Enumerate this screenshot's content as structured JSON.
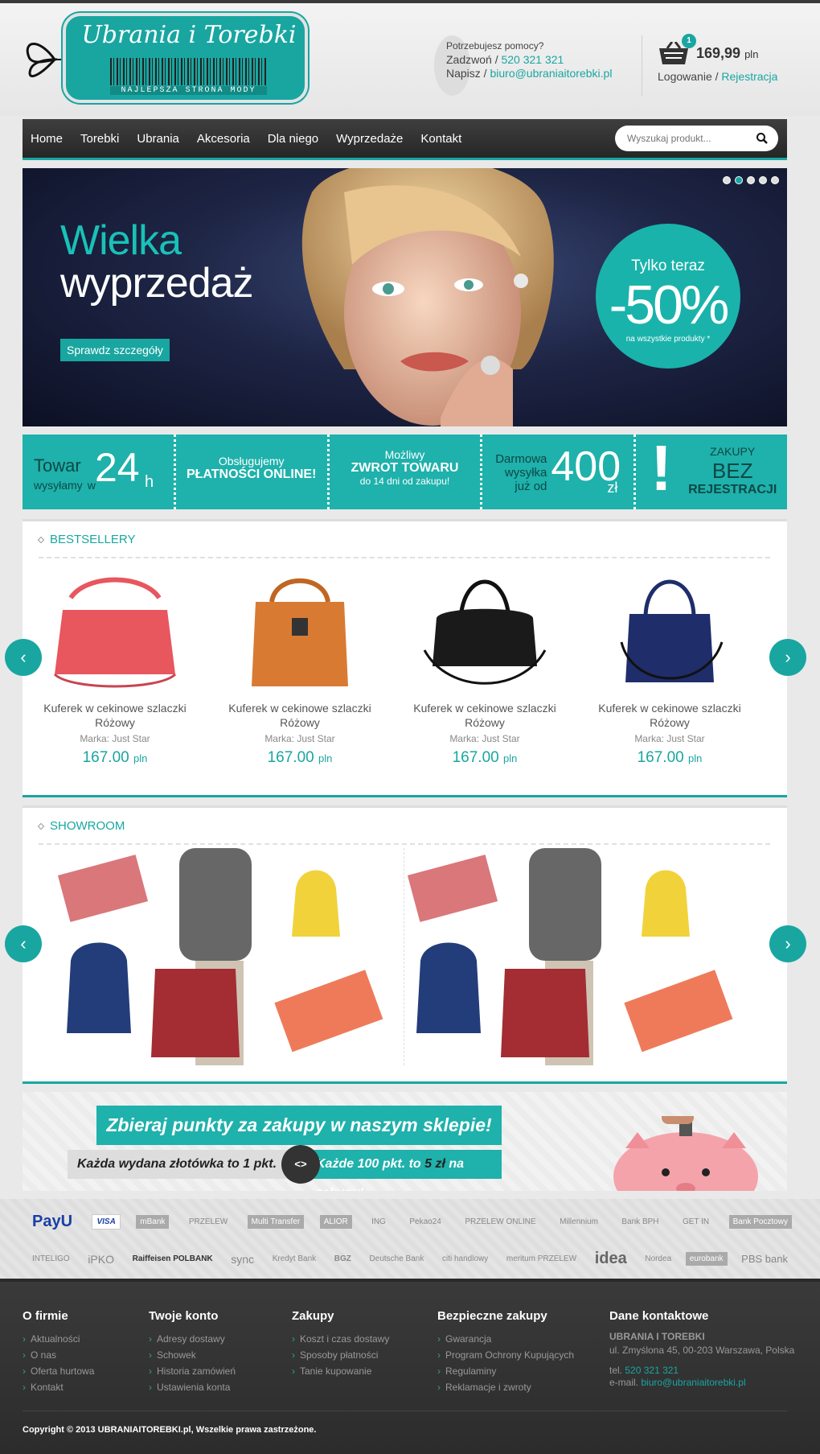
{
  "header": {
    "logo_title": "Ubrania i Torebki",
    "logo_subtitle": "NAJLEPSZA STRONA MODY",
    "help_title": "Potrzebujesz pomocy?",
    "call_label": "Zadzwoń",
    "phone": "520 321 321",
    "write_label": "Napisz",
    "email": "biuro@ubraniaitorebki.pl",
    "cart_count": "1",
    "cart_total": "169,99",
    "currency": "pln",
    "login": "Logowanie",
    "register": "Rejestracja"
  },
  "nav": {
    "items": [
      "Home",
      "Torebki",
      "Ubrania",
      "Akcesoria",
      "Dla niego",
      "Wyprzedaże",
      "Kontakt"
    ],
    "search_placeholder": "Wyszukaj produkt..."
  },
  "hero": {
    "title1": "Wielka",
    "title2": "wyprzedaż",
    "button": "Sprawdz szczegóły",
    "promo_top": "Tylko teraz",
    "promo_big": "-50%",
    "promo_small": "na wszystkie produkty *",
    "slides": 5,
    "active_slide": 2
  },
  "features": {
    "f1_a": "Towar",
    "f1_b": "wysyłamy",
    "f1_w": "w",
    "f1_num": "24",
    "f1_unit": "h",
    "f2_a": "Obsługujemy",
    "f2_b": "PŁATNOŚCI ONLINE!",
    "f3_a": "Możliwy",
    "f3_b": "ZWROT TOWARU",
    "f3_c": "do 14 dni od zakupu!",
    "f4_a": "Darmowa",
    "f4_b": "wysyłka",
    "f4_c": "już od",
    "f4_num": "400",
    "f4_unit": "zł",
    "f5_ex": "!",
    "f5_a": "ZAKUPY",
    "f5_b": "BEZ",
    "f5_c": "REJESTRACJI"
  },
  "bestsellers": {
    "title": "BESTSELLERY",
    "products": [
      {
        "name": "Kuferek w cekinowe szlaczki Różowy",
        "brand": "Marka: Just Star",
        "price": "167.00",
        "currency": "pln",
        "color": "#e8565e"
      },
      {
        "name": "Kuferek w cekinowe szlaczki Różowy",
        "brand": "Marka: Just Star",
        "price": "167.00",
        "currency": "pln",
        "color": "#d97a33"
      },
      {
        "name": "Kuferek w cekinowe szlaczki Różowy",
        "brand": "Marka: Just Star",
        "price": "167.00",
        "currency": "pln",
        "color": "#1a1a1a"
      },
      {
        "name": "Kuferek w cekinowe szlaczki Różowy",
        "brand": "Marka: Just Star",
        "price": "167.00",
        "currency": "pln",
        "color": "#1f2d6b"
      }
    ]
  },
  "showroom": {
    "title": "SHOWROOM"
  },
  "banner": {
    "headline": "Zbieraj punkty za zakupy w naszym sklepie!",
    "left": "Każda wydana złotówka to 1 pkt.",
    "btn": "<>",
    "right_a": "Każde 100 pkt. to",
    "right_b": "5 zł",
    "right_c": "na zakupy!"
  },
  "banks": {
    "row1": [
      "PayU",
      "VISA",
      "mBank",
      "PRZELEW",
      "Multi Transfer",
      "ALIOR",
      "ING",
      "Pekao24",
      "PRZELEW ONLINE",
      "Millennium",
      "Bank BPH",
      "GET IN",
      "Bank Pocztowy"
    ],
    "row2": [
      "INTELIGO",
      "iPKO",
      "Raiffeisen POLBANK",
      "sync",
      "Kredyt Bank",
      "BGZ",
      "Deutsche Bank",
      "citi handlowy",
      "meritum PRZELEW",
      "idea",
      "Nordea",
      "eurobank",
      "PBS bank"
    ]
  },
  "footer": {
    "col1_title": "O firmie",
    "col1": [
      "Aktualności",
      "O nas",
      "Oferta hurtowa",
      "Kontakt"
    ],
    "col2_title": "Twoje konto",
    "col2": [
      "Adresy dostawy",
      "Schowek",
      "Historia zamówień",
      "Ustawienia konta"
    ],
    "col3_title": "Zakupy",
    "col3": [
      "Koszt i czas dostawy",
      "Sposoby płatności",
      "Tanie kupowanie"
    ],
    "col4_title": "Bezpieczne zakupy",
    "col4": [
      "Gwarancja",
      "Program Ochrony Kupujących",
      "Regulaminy",
      "Reklamacje i zwroty"
    ],
    "col5_title": "Dane kontaktowe",
    "company": "UBRANIA I TOREBKI",
    "address": "ul. Zmyślona 45, 00-203 Warszawa, Polska",
    "tel_label": "tel.",
    "tel": "520 321 321",
    "email_label": "e-mail.",
    "email": "biuro@ubraniaitorebki.pl",
    "copyright": "Copyright © 2013 UBRANIAITOREBKI.pl, Wszelkie prawa zastrzeżone."
  }
}
